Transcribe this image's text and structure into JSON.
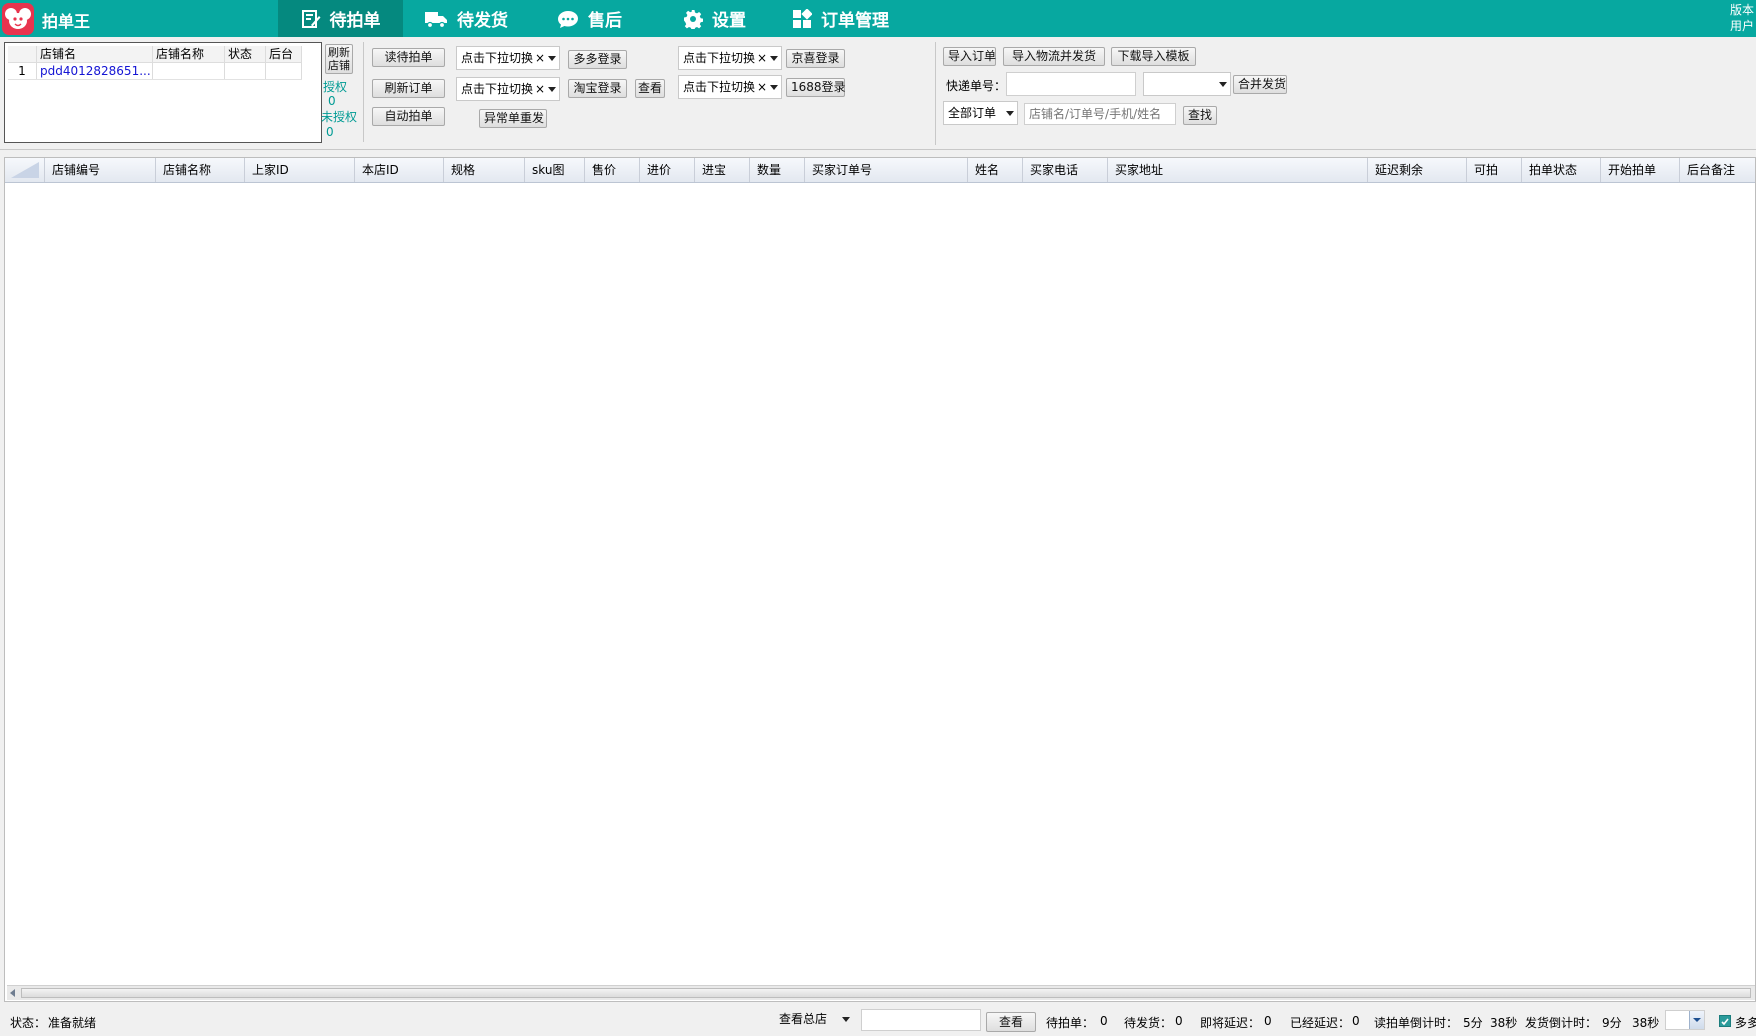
{
  "app": {
    "title": "拍单王",
    "version_label": "版本号:",
    "user_label": "用户名:"
  },
  "nav": [
    {
      "label": "待拍单",
      "icon": "edit-icon"
    },
    {
      "label": "待发货",
      "icon": "truck-icon"
    },
    {
      "label": "售后",
      "icon": "chat-icon"
    },
    {
      "label": "设置",
      "icon": "gear-icon"
    },
    {
      "label": "订单管理",
      "icon": "grid-icon"
    }
  ],
  "stores": {
    "headers": [
      "店铺名",
      "店铺名称",
      "状态",
      "后台"
    ],
    "rows": [
      {
        "index": "1",
        "name": "pdd4012828651...",
        "store_name": "",
        "status": "",
        "backend": ""
      }
    ],
    "refresh_label": "刷新店铺",
    "authorized_label": "授权",
    "authorized_count": "0",
    "unauthorized_label": "未授权",
    "unauthorized_count": "0"
  },
  "actions": {
    "read_orders": "读待拍单",
    "refresh_orders": "刷新订单",
    "auto_order": "自动拍单",
    "abnormal_resend": "异常单重发",
    "dropdown_placeholder": "点击下拉切换",
    "clear_glyph": "×",
    "duoduo_login": "多多登录",
    "taobao_login": "淘宝登录",
    "view": "查看",
    "jingxi_login": "京喜登录",
    "login_1688": "1688登录"
  },
  "tools": {
    "import_orders": "导入订单",
    "import_logistics": "导入物流并发货",
    "download_template": "下载导入模板",
    "express_label": "快递单号：",
    "merge_ship": "合并发货",
    "filter_value": "全部订单",
    "search_placeholder": "店铺名/订单号/手机/姓名",
    "search_button": "查找"
  },
  "grid": {
    "columns": [
      "店铺编号",
      "店铺名称",
      "上家ID",
      "本店ID",
      "规格",
      "sku图",
      "售价",
      "进价",
      "进宝",
      "数量",
      "买家订单号",
      "姓名",
      "买家电话",
      "买家地址",
      "延迟剩余",
      "可拍",
      "拍单状态",
      "开始拍单",
      "后台备注"
    ]
  },
  "status": {
    "state_label": "状态：",
    "state_value": "准备就绪",
    "view_store": "查看总店",
    "view_button": "查看",
    "pending_order_label": "待拍单：",
    "pending_order": "0",
    "pending_ship_label": "待发货：",
    "pending_ship": "0",
    "near_delay_label": "即将延迟：",
    "near_delay": "0",
    "delayed_label": "已经延迟：",
    "delayed": "0",
    "read_countdown_label": "读拍单倒计时：",
    "read_countdown_min": "5分",
    "read_countdown_sec": "38秒",
    "ship_countdown_label": "发货倒计时：",
    "ship_countdown_min": "9分",
    "ship_countdown_sec": "38秒",
    "multi_label": "多多"
  },
  "colors": {
    "header_bg": "#07a8a0",
    "header_active": "#05897f",
    "accent_text": "#009b94",
    "logo_bg": "#e8344e"
  }
}
